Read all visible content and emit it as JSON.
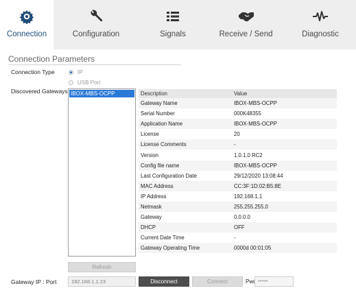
{
  "tabs": [
    {
      "label": "Connection",
      "icon": "connection-gear-icon",
      "active": true
    },
    {
      "label": "Configuration",
      "icon": "wrench-icon",
      "active": false
    },
    {
      "label": "Signals",
      "icon": "list-icon",
      "active": false
    },
    {
      "label": "Receive / Send",
      "icon": "handshake-icon",
      "active": false
    },
    {
      "label": "Diagnostic",
      "icon": "pulse-icon",
      "active": false
    }
  ],
  "section": {
    "title": "Connection Parameters"
  },
  "connection_type": {
    "label": "Connection Type",
    "options": [
      {
        "label": "IP",
        "selected": true
      },
      {
        "label": "USB Port",
        "selected": false
      }
    ]
  },
  "gateways": {
    "label": "Discovered Gateways",
    "items": [
      "IBOX-MBS-OCPP"
    ],
    "selected": "IBOX-MBS-OCPP"
  },
  "properties": {
    "headers": [
      "Description",
      "Value"
    ],
    "rows": [
      [
        "Gateway Name",
        "IBOX-MBS-OCPP"
      ],
      [
        "Serial Number",
        "000K48355"
      ],
      [
        "Application Name",
        "IBOX-MBS-OCPP"
      ],
      [
        "License",
        "20"
      ],
      [
        "License Comments",
        "-"
      ],
      [
        "Version",
        "1.0.1.0 RC2"
      ],
      [
        "Config file name",
        "IBOX-MBS-OCPP"
      ],
      [
        "Last Configuration Date",
        "29/12/2020 13:08:44"
      ],
      [
        "MAC Address",
        "CC:3F:1D:02:B5:8E"
      ],
      [
        "IP Address",
        "192.168.1.1"
      ],
      [
        "Netmask",
        "255.255.255.0"
      ],
      [
        "Gateway",
        "0.0.0.0"
      ],
      [
        "DHCP",
        "OFF"
      ],
      [
        "Current Date Time",
        "-"
      ],
      [
        "Gateway Operating Time",
        "0000d 00:01:05"
      ]
    ]
  },
  "actions": {
    "refresh": "Refresh",
    "gateway_ip_label": "Gateway IP : Port",
    "gateway_ip_value": "192.168.1.1:23",
    "disconnect": "Disconnect",
    "connect": "Connect",
    "pwd_label": "Pwd:",
    "pwd_value": "*****"
  },
  "colors": {
    "accent": "#1f4e79",
    "selection": "#2b79d6",
    "tab_bg": "#eeeeee"
  }
}
